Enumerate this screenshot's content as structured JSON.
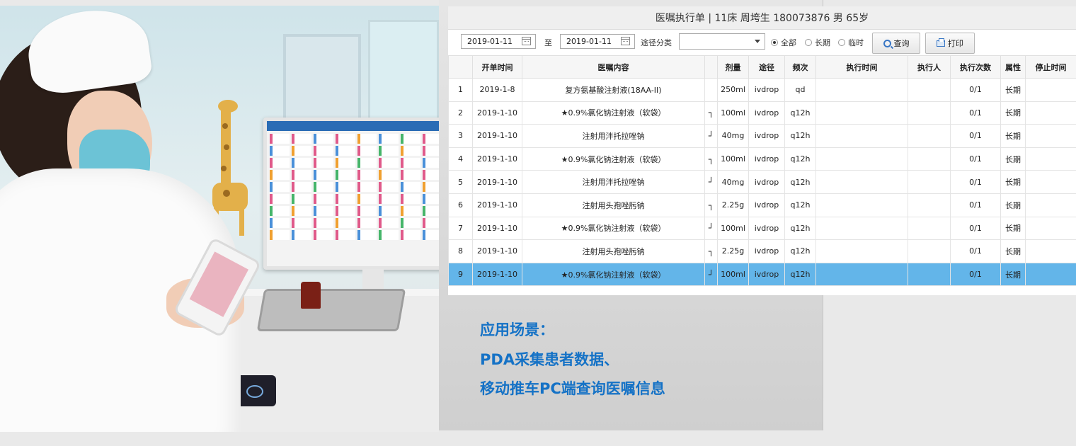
{
  "window": {
    "title": "医嘱执行单 | 11床 周垮生 180073876 男 65岁"
  },
  "toolbar": {
    "start_date": "2019-01-11",
    "to_label": "至",
    "end_date": "2019-01-11",
    "route_label": "途径分类",
    "route_value": "",
    "radios": [
      {
        "label": "全部",
        "checked": true
      },
      {
        "label": "长期",
        "checked": false
      },
      {
        "label": "临时",
        "checked": false
      }
    ],
    "query_label": "查询",
    "print_label": "打印"
  },
  "table": {
    "headers": [
      "",
      "开单时间",
      "医嘱内容",
      "",
      "剂量",
      "途径",
      "频次",
      "执行时间",
      "执行人",
      "执行次数",
      "属性",
      "停止时间"
    ],
    "rows": [
      {
        "no": "1",
        "time": "2019-1-8",
        "content": "复方氨基酸注射液(18AA-II)",
        "mark": "",
        "dose": "250ml",
        "route": "ivdrop",
        "freq": "qd",
        "exec_time": "",
        "executor": "",
        "count": "0/1",
        "attr": "长期",
        "stop": ""
      },
      {
        "no": "2",
        "time": "2019-1-10",
        "content": "★0.9%氯化钠注射液（软袋）",
        "mark": "┐",
        "dose": "100ml",
        "route": "ivdrop",
        "freq": "q12h",
        "exec_time": "",
        "executor": "",
        "count": "0/1",
        "attr": "长期",
        "stop": ""
      },
      {
        "no": "3",
        "time": "2019-1-10",
        "content": "注射用泮托拉唑钠",
        "mark": "┘",
        "dose": "40mg",
        "route": "ivdrop",
        "freq": "q12h",
        "exec_time": "",
        "executor": "",
        "count": "0/1",
        "attr": "长期",
        "stop": ""
      },
      {
        "no": "4",
        "time": "2019-1-10",
        "content": "★0.9%氯化钠注射液（软袋）",
        "mark": "┐",
        "dose": "100ml",
        "route": "ivdrop",
        "freq": "q12h",
        "exec_time": "",
        "executor": "",
        "count": "0/1",
        "attr": "长期",
        "stop": ""
      },
      {
        "no": "5",
        "time": "2019-1-10",
        "content": "注射用泮托拉唑钠",
        "mark": "┘",
        "dose": "40mg",
        "route": "ivdrop",
        "freq": "q12h",
        "exec_time": "",
        "executor": "",
        "count": "0/1",
        "attr": "长期",
        "stop": ""
      },
      {
        "no": "6",
        "time": "2019-1-10",
        "content": "注射用头孢唑肟钠",
        "mark": "┐",
        "dose": "2.25g",
        "route": "ivdrop",
        "freq": "q12h",
        "exec_time": "",
        "executor": "",
        "count": "0/1",
        "attr": "长期",
        "stop": ""
      },
      {
        "no": "7",
        "time": "2019-1-10",
        "content": "★0.9%氯化钠注射液（软袋）",
        "mark": "┘",
        "dose": "100ml",
        "route": "ivdrop",
        "freq": "q12h",
        "exec_time": "",
        "executor": "",
        "count": "0/1",
        "attr": "长期",
        "stop": ""
      },
      {
        "no": "8",
        "time": "2019-1-10",
        "content": "注射用头孢唑肟钠",
        "mark": "┐",
        "dose": "2.25g",
        "route": "ivdrop",
        "freq": "q12h",
        "exec_time": "",
        "executor": "",
        "count": "0/1",
        "attr": "长期",
        "stop": ""
      },
      {
        "no": "9",
        "time": "2019-1-10",
        "content": "★0.9%氯化钠注射液（软袋）",
        "mark": "┘",
        "dose": "100ml",
        "route": "ivdrop",
        "freq": "q12h",
        "exec_time": "",
        "executor": "",
        "count": "0/1",
        "attr": "长期",
        "stop": "",
        "selected": true
      }
    ]
  },
  "caption": {
    "lines": [
      "应用场景：",
      "PDA采集患者数据、",
      "移动推车PC端查询医嘱信息"
    ]
  },
  "colors": {
    "selected_row": "#63b5e9",
    "caption": "#1572c6"
  },
  "icons": {
    "calendar": "calendar-icon",
    "dropdown": "chevron-down-icon",
    "query": "search-icon",
    "print": "printer-icon"
  }
}
